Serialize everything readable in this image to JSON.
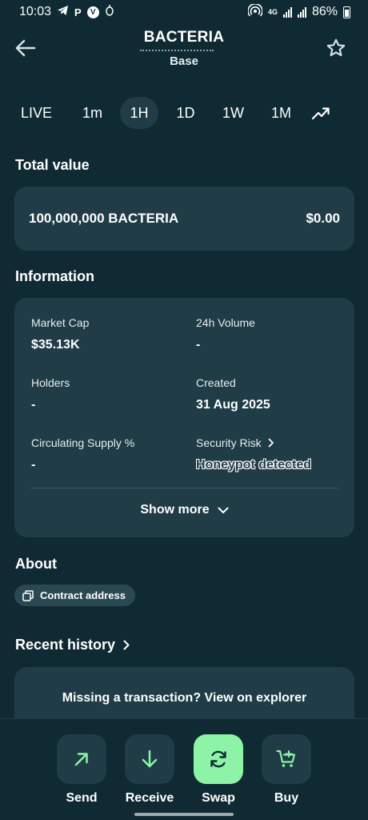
{
  "status_bar": {
    "time": "10:03",
    "notification_icons": [
      "telegram-icon",
      "p-icon",
      "v-icon",
      "bug-icon"
    ],
    "net_tag": "4G",
    "battery": "86%"
  },
  "header": {
    "title": "BACTERIA",
    "subtitle": "Base",
    "back_icon": "arrow-left-icon",
    "favorite_icon": "star-outline-icon"
  },
  "timeframes": {
    "items": [
      "LIVE",
      "1m",
      "1H",
      "1D",
      "1W",
      "1M"
    ],
    "selected": "1H",
    "chart_toggle_icon": "trending-up-icon"
  },
  "total_value": {
    "title": "Total value",
    "amount": "100,000,000 BACTERIA",
    "fiat": "$0.00"
  },
  "information": {
    "title": "Information",
    "market_cap_label": "Market Cap",
    "market_cap_value": "$35.13K",
    "volume_label": "24h Volume",
    "volume_value": "-",
    "holders_label": "Holders",
    "holders_value": "-",
    "created_label": "Created",
    "created_value": "31 Aug 2025",
    "supply_label": "Circulating Supply %",
    "supply_value": "-",
    "security_label": "Security Risk",
    "security_value": "Honeypot detected",
    "show_more": "Show more"
  },
  "about": {
    "title": "About",
    "contract_label": "Contract address"
  },
  "recent_history": {
    "title": "Recent history",
    "missing_text": "Missing a transaction? View on explorer"
  },
  "actions": {
    "send": "Send",
    "receive": "Receive",
    "swap": "Swap",
    "buy": "Buy"
  },
  "colors": {
    "background": "#102A34",
    "card": "#1F3C47",
    "accent": "#8DF3A6"
  }
}
